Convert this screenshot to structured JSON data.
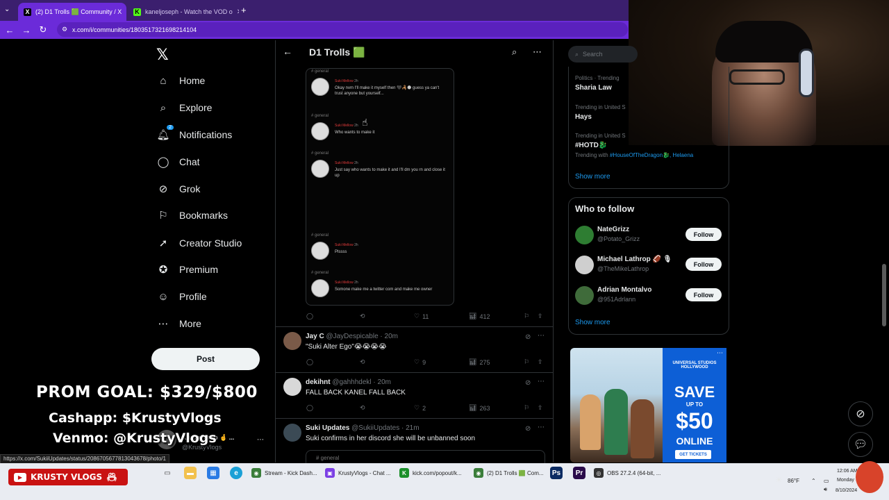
{
  "browser": {
    "tabs": [
      {
        "label": "(2) D1 Trolls 🟩 Community / X",
        "favicon": "X"
      },
      {
        "label": "kaneljoseph - Watch the VOD o",
        "favicon": "K"
      }
    ],
    "url": "x.com/i/communities/1803517321698214104",
    "new_tab": "+"
  },
  "sidebar": {
    "logo": "𝕏",
    "items": [
      {
        "label": "Home",
        "icon": "home-icon",
        "glyph": "⌂"
      },
      {
        "label": "Explore",
        "icon": "search-icon",
        "glyph": "⌕"
      },
      {
        "label": "Notifications",
        "icon": "bell-icon",
        "glyph": "🔔︎",
        "badge": "2"
      },
      {
        "label": "Chat",
        "icon": "chat-icon",
        "glyph": "◯"
      },
      {
        "label": "Grok",
        "icon": "grok-icon",
        "glyph": "⊘"
      },
      {
        "label": "Bookmarks",
        "icon": "bookmark-icon",
        "glyph": "⚐"
      },
      {
        "label": "Creator Studio",
        "icon": "rocket-icon",
        "glyph": "➚"
      },
      {
        "label": "Premium",
        "icon": "verified-icon",
        "glyph": "✪"
      },
      {
        "label": "Profile",
        "icon": "person-icon",
        "glyph": "☺"
      },
      {
        "label": "More",
        "icon": "more-icon",
        "glyph": "⋯"
      }
    ],
    "post_label": "Post",
    "account": {
      "name": "Krusty Crab 🤞 ...",
      "handle": "@KrustyVlogs"
    }
  },
  "community": {
    "title": "D1 Trolls 🟩"
  },
  "discord_shot": {
    "messages": [
      {
        "channel": "# general",
        "name": "Suki Mellow",
        "time": "2h",
        "text": "Okay nvm I'll make it myself then 🖤🦂🌑 guess ya can't trust anyone but yourself..."
      },
      {
        "channel": "# general",
        "name": "Suki Mellow",
        "time": "2h",
        "text": "Who wants to make it"
      },
      {
        "channel": "# general",
        "name": "Suki Mellow",
        "time": "2h",
        "text": "Just say who wants to make it and I'll dm you rn and close it up"
      },
      {
        "channel": "# general",
        "name": "Suki Mellow",
        "time": "2h",
        "text": "Plssss"
      },
      {
        "channel": "# general",
        "name": "Suki Mellow",
        "time": "2h",
        "text": "Somone make me a twitter com and make me owner"
      }
    ],
    "stats": {
      "likes": "11",
      "views": "412"
    }
  },
  "tweets": [
    {
      "name": "Jay C",
      "handle": "@JayDespicable",
      "time": "20m",
      "text": "\"Suki Alter Ego\"😭😭😭😭",
      "likes": "9",
      "views": "275"
    },
    {
      "name": "dekihnt",
      "handle": "@gahhhdekl",
      "time": "20m",
      "text": "FALL BACK KANEL FALL BACK",
      "likes": "2",
      "views": "263"
    },
    {
      "name": "Suki Updates",
      "handle": "@SukiiUpdates",
      "time": "21m",
      "text": "Suki confirms in her discord she will be unbanned soon",
      "preview": "# general"
    }
  ],
  "right": {
    "search_placeholder": "Search",
    "trends": [
      {
        "category": "Politics · Trending",
        "name": "Sharia Law"
      },
      {
        "category": "Trending in United S",
        "name": "Hays"
      },
      {
        "category": "Trending in United S",
        "name": "#HOTD🐉",
        "with_prefix": "Trending with",
        "with_links": "#HouseOfTheDragon🐉, Helaena"
      }
    ],
    "show_more": "Show more",
    "who_to_follow": {
      "title": "Who to follow",
      "follow_label": "Follow",
      "accounts": [
        {
          "name": "NateGrizz",
          "handle": "@Potato_Grizz"
        },
        {
          "name": "Michael Lathrop 🏈 🎙",
          "handle": "@TheMikeLathrop"
        },
        {
          "name": "Adrian Montalvo",
          "handle": "@951Adrlann"
        }
      ],
      "show_more": "Show more"
    },
    "ad": {
      "brand": "UNIVERSAL STUDIOS HOLLYWOOD",
      "save": "SAVE",
      "up_to": "UP TO",
      "amount": "$50",
      "online": "ONLINE",
      "cta": "GET TICKETS"
    }
  },
  "overlay": {
    "goal": "PROM GOAL: $329/$800",
    "cashapp": "Cashapp: $KrustyVlogs",
    "venmo": "Venmo: @KrustyVlogs",
    "channel_badge": "KRUSTY VLOGS"
  },
  "status_url": "https://x.com/SukiiUpdates/status/2086705677813043678/photo/1",
  "taskbar": {
    "apps": [
      {
        "label": "Stream - Kick Dash...",
        "color": "#e5e5e5"
      },
      {
        "label": "KrustyVlogs - Chat ...",
        "color": "#e5e5e5"
      },
      {
        "label": "kick.com/popout/k...",
        "color": "#e5e5e5"
      },
      {
        "label": "(2) D1 Trolls 🟩 Com...",
        "color": "#e5e5e5"
      },
      {
        "label": "OBS 27.2.4 (64-bit, ...",
        "color": "#e5e5e5"
      }
    ],
    "weather": "86°F",
    "time": "12:06 AM",
    "day": "Monday",
    "date": "8/10/2024"
  }
}
